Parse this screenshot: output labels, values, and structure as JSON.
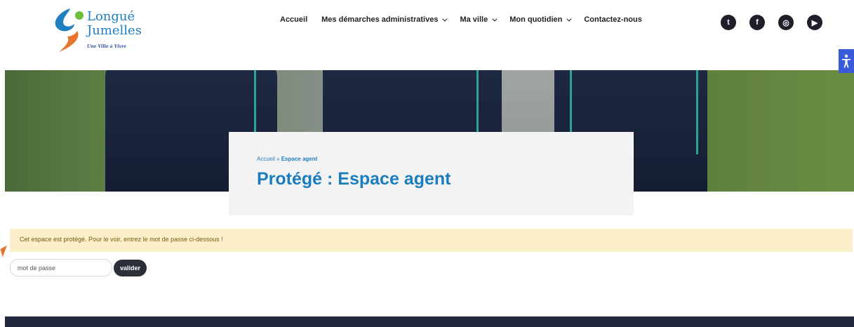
{
  "logo": {
    "line1": "Longué",
    "line2": "Jumelles",
    "tagline": "Une Ville à Vivre"
  },
  "nav": {
    "items": [
      {
        "label": "Accueil",
        "dropdown": false
      },
      {
        "label": "Mes démarches administratives",
        "dropdown": true
      },
      {
        "label": "Ma ville",
        "dropdown": true
      },
      {
        "label": "Mon quotidien",
        "dropdown": true
      },
      {
        "label": "Contactez-nous",
        "dropdown": false
      }
    ]
  },
  "socials": [
    {
      "icon": "twitter-icon",
      "glyph": "t"
    },
    {
      "icon": "facebook-icon",
      "glyph": "f"
    },
    {
      "icon": "instagram-icon",
      "glyph": "◎"
    },
    {
      "icon": "youtube-icon",
      "glyph": "▶"
    }
  ],
  "accessibility": {
    "icon": "accessibility-icon",
    "glyph": "♿"
  },
  "hero": {
    "breadcrumb_home": "Accueil",
    "breadcrumb_sep": "»",
    "breadcrumb_current": "Espace agent",
    "title": "Protégé : Espace agent"
  },
  "notice": {
    "text": "Cet espace est protégé. Pour le voir, entrez le mot de passe ci-dessous !"
  },
  "password_form": {
    "placeholder": "mot de passe",
    "submit_label": "valider"
  },
  "colors": {
    "accent": "#1b7dbd",
    "notice_bg": "#fbf0c9",
    "footer_bg": "#22283d",
    "access_bg": "#3a5bd9"
  }
}
